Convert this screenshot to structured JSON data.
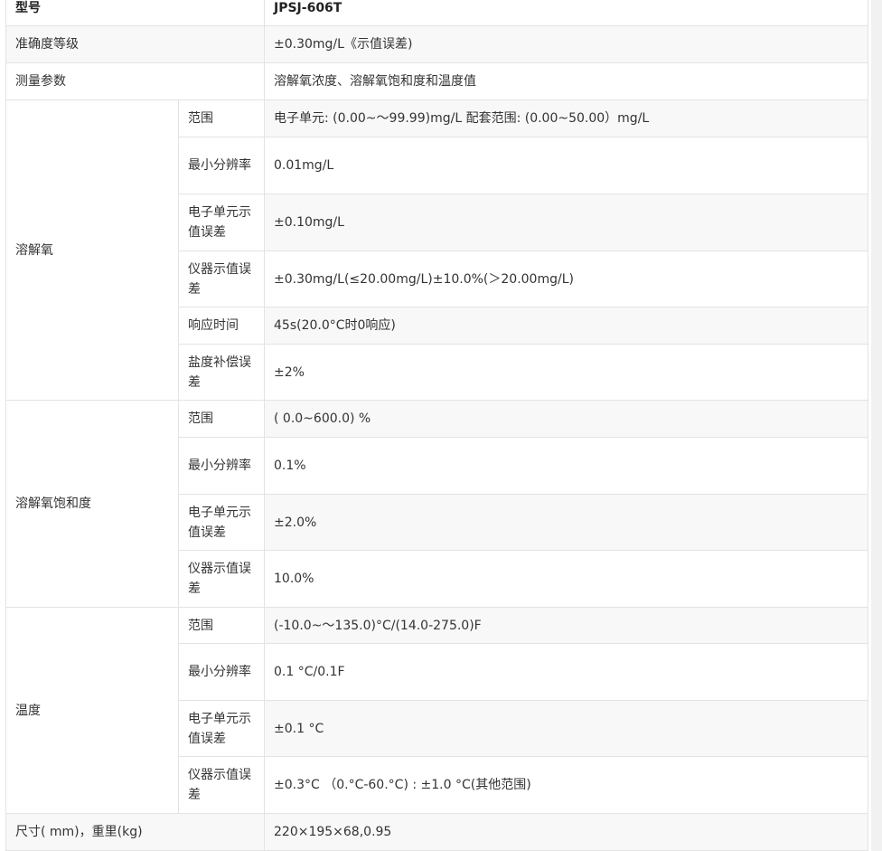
{
  "header": {
    "label": "型号",
    "value": "JPSJ-606T"
  },
  "rows_top": [
    {
      "label": "准确度等级",
      "value": "±0.30mg/L《示值误差)"
    },
    {
      "label": "测量参数",
      "value": "溶解氧浓度、溶解氧饱和度和温度值"
    }
  ],
  "groups": [
    {
      "name": "溶解氧",
      "items": [
        {
          "label": "范围",
          "value": "电子单元: (0.00~～99.99)mg/L 配套范围: (0.00~50.00）mg/L"
        },
        {
          "label": "最小分辨率",
          "value": "0.01mg/L"
        },
        {
          "label": "电子单元示值误差",
          "value": "±0.10mg/L"
        },
        {
          "label": "仪器示值误差",
          "value": "±0.30mg/L(≤20.00mg/L)±10.0%(＞20.00mg/L)"
        },
        {
          "label": "响应时间",
          "value": "45s(20.0°C时0响应)"
        },
        {
          "label": "盐度补偿误差",
          "value": "±2%"
        }
      ]
    },
    {
      "name": "溶解氧饱和度",
      "items": [
        {
          "label": "范围",
          "value": "( 0.0~600.0) %"
        },
        {
          "label": "最小分辨率",
          "value": "0.1%"
        },
        {
          "label": "电子单元示值误差",
          "value": "±2.0%"
        },
        {
          "label": "仪器示值误差",
          "value": "10.0%"
        }
      ]
    },
    {
      "name": "温度",
      "items": [
        {
          "label": "范围",
          "value": "(-10.0~～135.0)°C/(14.0-275.0)F"
        },
        {
          "label": "最小分辨率",
          "value": "0.1 °C/0.1F"
        },
        {
          "label": "电子单元示值误差",
          "value": "±0.1 °C"
        },
        {
          "label": "仪器示值误差",
          "value": "±0.3°C （0.°C-60.°C) : ±1.0 °C(其他范围)"
        }
      ]
    }
  ],
  "footer": {
    "label": "尺寸( mm)，重里(kg)",
    "value": "220×195×68,0.95"
  }
}
